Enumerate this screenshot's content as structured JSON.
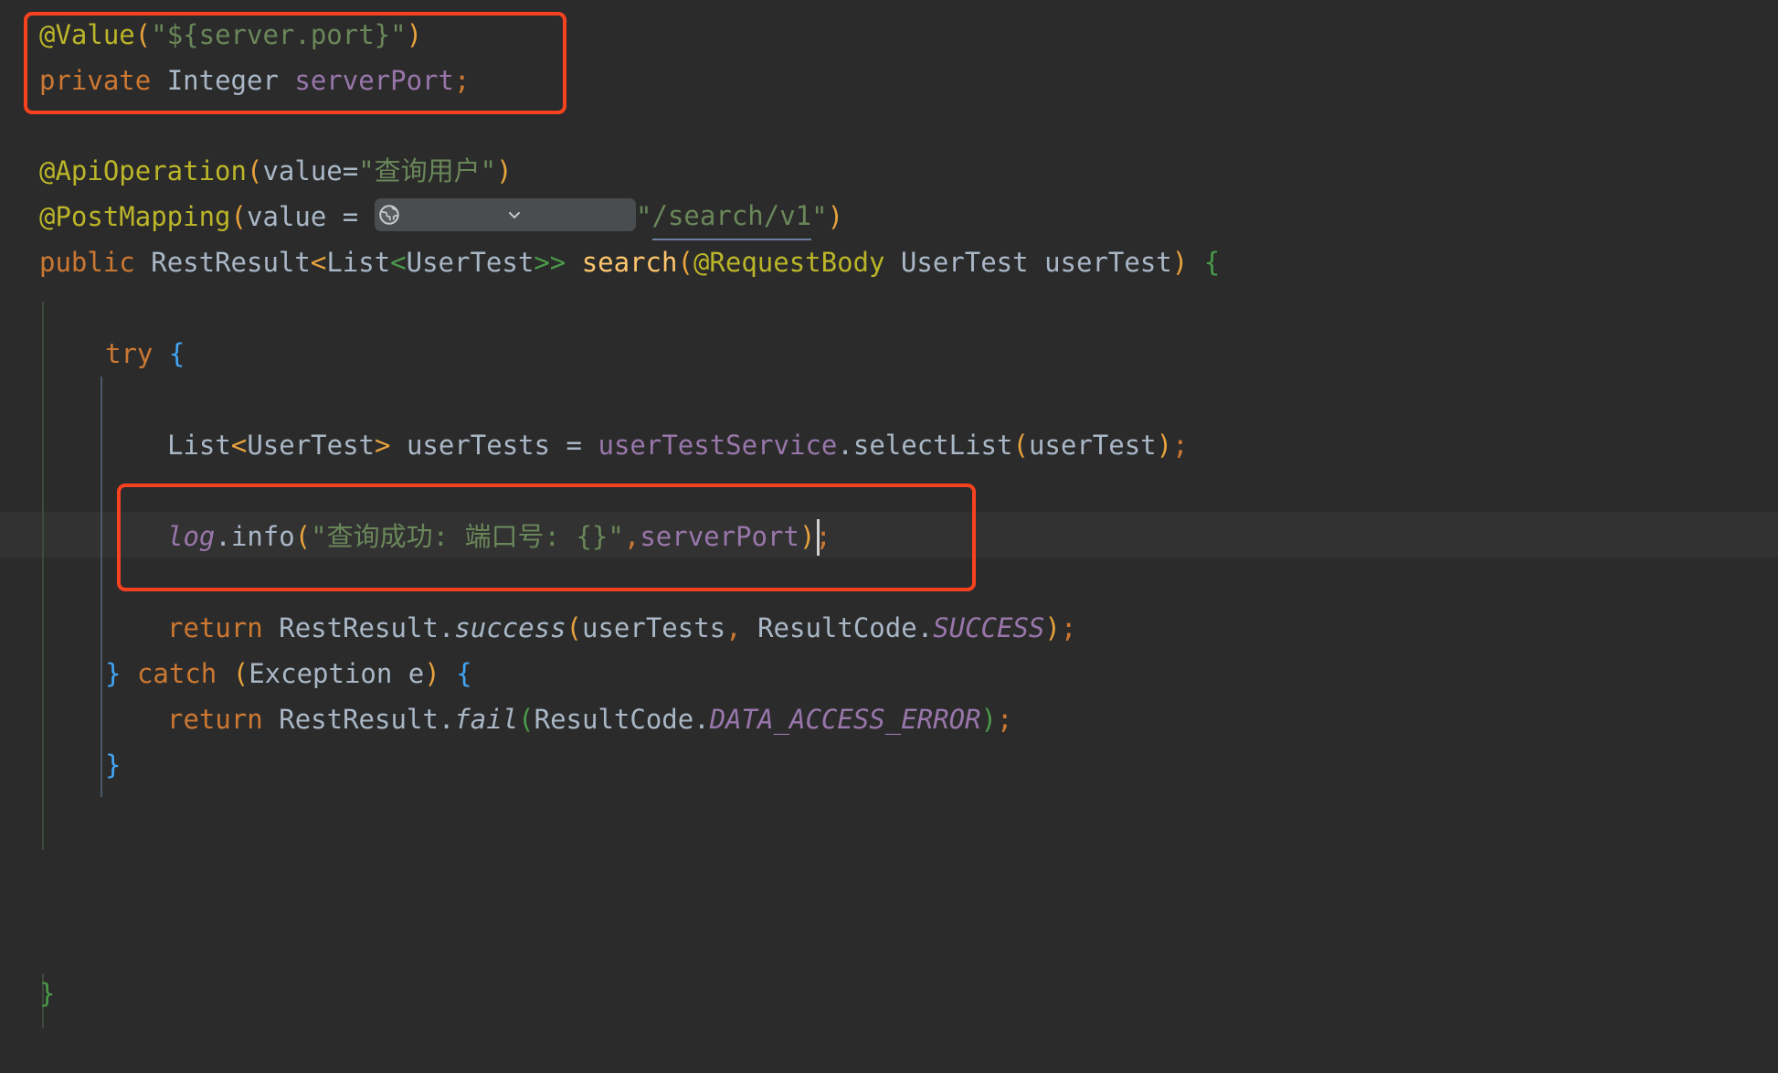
{
  "editor": {
    "background": "#2b2b2b",
    "current_line_background": "#323232",
    "annotation_color": "#f6421f",
    "font_size_px": 29,
    "line_height_px": 50
  },
  "code": {
    "line1": {
      "annotation": "@Value",
      "paren_open": "(",
      "string": "\"${server.port}\"",
      "paren_close": ")"
    },
    "line2": {
      "keyword": "private",
      "type": "Integer",
      "field": "serverPort",
      "semicolon": ";"
    },
    "line3": {
      "annotation": "@ApiOperation",
      "paren_open": "(",
      "param": "value=",
      "string": "\"查询用户\"",
      "paren_close": ")"
    },
    "line4": {
      "annotation": "@PostMapping",
      "paren_open": "(",
      "param": "value = ",
      "icon": "globe-icon",
      "icon_chevron": "chevron-down-icon",
      "quote_open": "\"",
      "link": "/search/v1",
      "quote_close": "\"",
      "paren_close": ")"
    },
    "line5": {
      "keyword": "public",
      "type": "RestResult",
      "angle_open": "<",
      "inner_type": "List",
      "inner_angle_open": "<",
      "generic_type": "UserTest",
      "angle_close": ">>",
      "method": "search",
      "paren_open": "(",
      "annotation": "@RequestBody",
      "param_type": "UserTest",
      "param_name": "userTest",
      "paren_close": ")",
      "brace_open": "{"
    },
    "line6": {
      "keyword": "try",
      "brace_open": "{"
    },
    "line7": {
      "type": "List",
      "angle_open": "<",
      "generic_type": "UserTest",
      "angle_close": ">",
      "var": "userTests",
      "equals": "=",
      "object": "userTestService",
      "dot": ".",
      "method": "selectList",
      "paren_open": "(",
      "arg": "userTest",
      "paren_close": ")",
      "semicolon": ";"
    },
    "line8": {
      "object": "log",
      "dot": ".",
      "method": "info",
      "paren_open": "(",
      "string": "\"查询成功: 端口号: {}\"",
      "comma": ",",
      "arg": "serverPort",
      "paren_close": ")",
      "semicolon": ";"
    },
    "line9": {
      "keyword": "return",
      "type": "RestResult",
      "dot": ".",
      "method": "success",
      "paren_open": "(",
      "arg1": "userTests",
      "comma": ",",
      "enum_type": "ResultCode",
      "dot2": ".",
      "enum_value": "SUCCESS",
      "paren_close": ")",
      "semicolon": ";"
    },
    "line10": {
      "brace_close": "}",
      "keyword": "catch",
      "paren_open": "(",
      "exception_type": "Exception",
      "exception_var": "e",
      "paren_close": ")",
      "brace_open": "{"
    },
    "line11": {
      "keyword": "return",
      "type": "RestResult",
      "dot": ".",
      "method": "fail",
      "paren_open": "(",
      "enum_type": "ResultCode",
      "dot2": ".",
      "enum_value": "DATA_ACCESS_ERROR",
      "paren_close": ")",
      "semicolon": ";"
    },
    "line12": {
      "brace_close": "}"
    },
    "line13": {
      "brace_close": "}"
    }
  },
  "colors": {
    "keyword": "#cc7832",
    "annotation": "#bbb529",
    "string": "#6a8759",
    "field": "#9876aa",
    "plain": "#a9b7c6",
    "method_decl": "#ffc66d",
    "paren_gold": "#e8a33d",
    "brace_blue": "#41a6f6",
    "brace_green": "#4a9a4a"
  }
}
